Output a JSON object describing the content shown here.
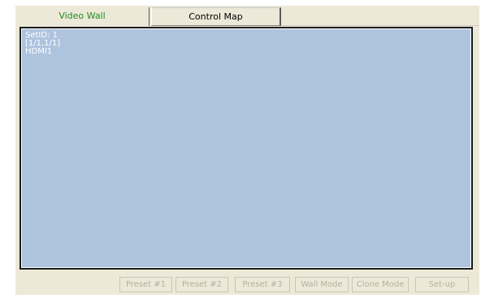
{
  "tabs": [
    {
      "label": "Video Wall",
      "active": true
    },
    {
      "label": "Control Map",
      "active": false
    }
  ],
  "wall": {
    "background_color": "#adc3de",
    "set_id": "SetID: 1",
    "position": "[1/1,1/1]",
    "input": "HDMI1"
  },
  "buttons": [
    {
      "label": "Preset #1",
      "enabled": false
    },
    {
      "label": "Preset #2",
      "enabled": false
    },
    {
      "label": "Preset #3",
      "enabled": false
    },
    {
      "label": "Wall Mode",
      "enabled": false
    },
    {
      "label": "Clone Mode",
      "enabled": false
    },
    {
      "label": "Set-up",
      "enabled": false
    }
  ]
}
